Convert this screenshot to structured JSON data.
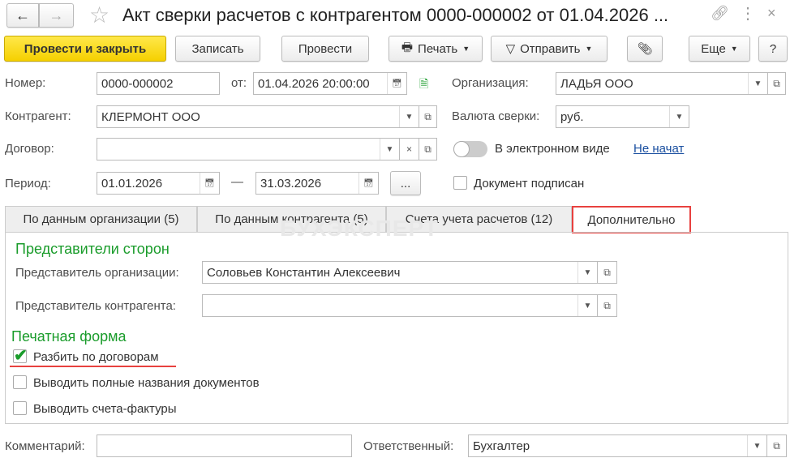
{
  "title": "Акт сверки расчетов с контрагентом 0000-000002 от 01.04.2026 ...",
  "toolbar": {
    "post_close": "Провести и закрыть",
    "save": "Записать",
    "post": "Провести",
    "print": "Печать",
    "send": "Отправить",
    "more": "Еще",
    "help": "?"
  },
  "fields": {
    "number_label": "Номер:",
    "number": "0000-000002",
    "from_label": "от:",
    "date": "01.04.2026 20:00:00",
    "org_label": "Организация:",
    "org": "ЛАДЬЯ ООО",
    "contractor_label": "Контрагент:",
    "contractor": "КЛЕРМОНТ ООО",
    "currency_label": "Валюта сверки:",
    "currency": "руб.",
    "contract_label": "Договор:",
    "contract": "",
    "electronic_label": "В электронном виде",
    "electronic_status": "Не начат",
    "period_label": "Период:",
    "period_from": "01.01.2026",
    "dash": "—",
    "period_to": "31.03.2026",
    "period_btn": "...",
    "signed_label": "Документ подписан"
  },
  "tabs": [
    "По данным организации (5)",
    "По данным контрагента (5)",
    "Счета учета расчетов (12)",
    "Дополнительно"
  ],
  "watermark": "БУХЭКСПЕРТ",
  "panel": {
    "reps_heading": "Представители сторон",
    "org_rep_label": "Представитель организации:",
    "org_rep": "Соловьев Константин Алексеевич",
    "contr_rep_label": "Представитель контрагента:",
    "contr_rep": "",
    "print_heading": "Печатная форма",
    "checks": [
      {
        "label": "Разбить по договорам",
        "checked": true
      },
      {
        "label": "Выводить полные названия документов",
        "checked": false
      },
      {
        "label": "Выводить счета-фактуры",
        "checked": false
      }
    ]
  },
  "footer": {
    "comment_label": "Комментарий:",
    "comment": "",
    "responsible_label": "Ответственный:",
    "responsible": "Бухгалтер"
  }
}
